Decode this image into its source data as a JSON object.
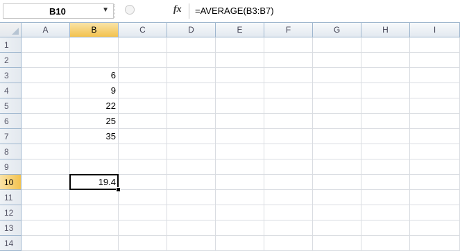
{
  "formula_bar": {
    "name_box": "B10",
    "fx_icon": "fx-icon",
    "formula": "=AVERAGE(B3:B7)"
  },
  "columns": [
    "A",
    "B",
    "C",
    "D",
    "E",
    "F",
    "G",
    "H",
    "I"
  ],
  "rows": [
    "1",
    "2",
    "3",
    "4",
    "5",
    "6",
    "7",
    "8",
    "9",
    "10",
    "11",
    "12",
    "13",
    "14"
  ],
  "selected": {
    "column": "B",
    "row": "10"
  },
  "cells": {
    "B3": "6",
    "B4": "9",
    "B5": "22",
    "B6": "25",
    "B7": "35",
    "B10": "19.4"
  },
  "colors": {
    "header_border": "#9eb6ce",
    "selected_header": "#f3c24e",
    "gridline": "#d9dce1"
  }
}
